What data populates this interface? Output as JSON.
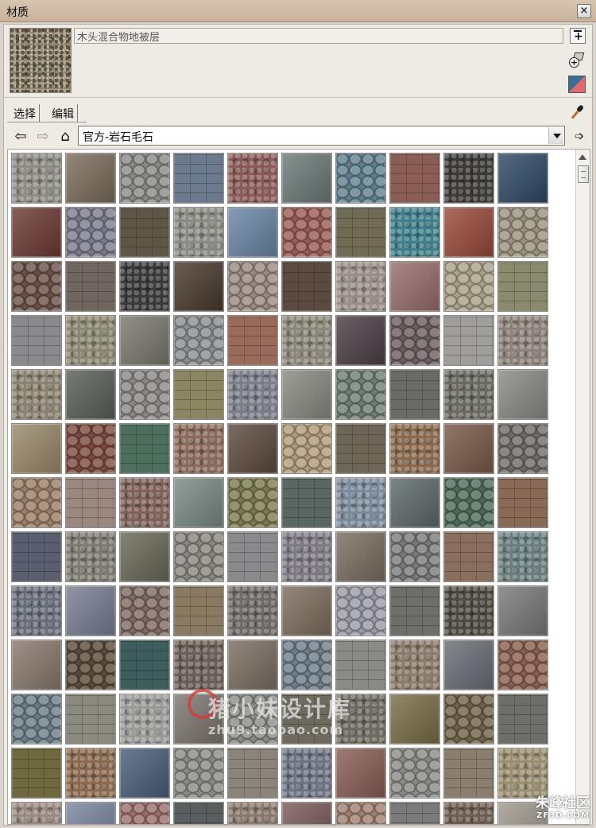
{
  "window": {
    "title": "材质",
    "close_glyph": "×"
  },
  "material": {
    "name_value": "木头混合物地被层"
  },
  "tabs": [
    {
      "label": "选择"
    },
    {
      "label": "编辑"
    }
  ],
  "nav": {
    "back_glyph": "⇦",
    "forward_glyph": "⇨",
    "home_glyph": "⌂"
  },
  "library": {
    "selected": "官方-岩石毛石",
    "export_glyph": "➩"
  },
  "icons": {
    "create": "create-material-icon",
    "in_model": "materials-in-model-icon",
    "default_color": "default-color-icon",
    "sample": "eyedropper-icon"
  },
  "watermark": {
    "text": "猪小妹设计库",
    "sub": "zhu9.taobao.com"
  },
  "corner_mark": {
    "text": "朱峰社区",
    "sub": "ZF3D.COM"
  },
  "swatch_colors": [
    "#8e8b84",
    "#7b6d5c",
    "#8a8987",
    "#6b7a8c",
    "#8a5a58",
    "#6b7b78",
    "#5f7f8f",
    "#8a5e54",
    "#3c3b3a",
    "#2f4a66",
    "#6e3a34",
    "#7b7a8c",
    "#5e5748",
    "#8a8a84",
    "#6a87a8",
    "#9a5a54",
    "#6f6b55",
    "#3f7f8a",
    "#9a4a3a",
    "#9a9280",
    "#6a5048",
    "#6f6660",
    "#3a3a3a",
    "#4a3a2e",
    "#9a8a80",
    "#5a4a40",
    "#9a8e88",
    "#9a6e6e",
    "#a8a088",
    "#8a8a6e",
    "#8a8a8e",
    "#8a8670",
    "#7a7a6e",
    "#8a8e90",
    "#9a6a5a",
    "#8a8678",
    "#4a4046",
    "#6a5e60",
    "#a09e9a",
    "#8a8278",
    "#8a8270",
    "#5a6058",
    "#8a8886",
    "#8a8662",
    "#7a7e88",
    "#8a8a84",
    "#6e7e74",
    "#6a6a66",
    "#6a6a62",
    "#8a8a86",
    "#9a8a6a",
    "#7a4a3e",
    "#4e6e5e",
    "#8a6a5a",
    "#5e4a3e",
    "#b09a7a",
    "#6e6656",
    "#8a6a4e",
    "#7a5a4a",
    "#6e6a68",
    "#9a7e66",
    "#9a8880",
    "#7e6258",
    "#7a8a84",
    "#7a7a4e",
    "#5a6662",
    "#7a8a9a",
    "#5e6a6a",
    "#4e6a5a",
    "#8a6a56",
    "#5a5e6e",
    "#7e7a72",
    "#6a6a58",
    "#8a8680",
    "#8a8a8c",
    "#7e7a84",
    "#7a6e62",
    "#7a7a7a",
    "#8a6e5e",
    "#6a7e7e",
    "#6a6e7a",
    "#7a7e92",
    "#7e6a62",
    "#8a7a62",
    "#6e6a66",
    "#7e6e5e",
    "#9a9aa6",
    "#6e6e6a",
    "#4e4a40",
    "#7a7a7a",
    "#8a7a6e",
    "#5a4a3a",
    "#3e5e5e",
    "#6a5e56",
    "#7a6e62",
    "#6e7e8a",
    "#8a8a86",
    "#8a7a6a",
    "#6a6e76",
    "#8a5e4e",
    "#6a7e86",
    "#8a8a7e",
    "#9a9a98",
    "#7e7670",
    "#8a8a86",
    "#6e6a5e",
    "#6e6a62",
    "#7a6e48",
    "#6e6248",
    "#6e6e6a",
    "#6e6a3e",
    "#8a6a4e",
    "#4a5e7a",
    "#8a8a86",
    "#8a847a",
    "#6e7486",
    "#8a5e56",
    "#8a8a88",
    "#8a7e6e",
    "#9a8e70",
    "#9a8a80",
    "#7a86a0",
    "#9a6e6a",
    "#5a5e5e",
    "#8a7a6e",
    "#7a5a5a",
    "#a08070",
    "#7a7a7a",
    "#6e5e52",
    "#a09a8e"
  ]
}
